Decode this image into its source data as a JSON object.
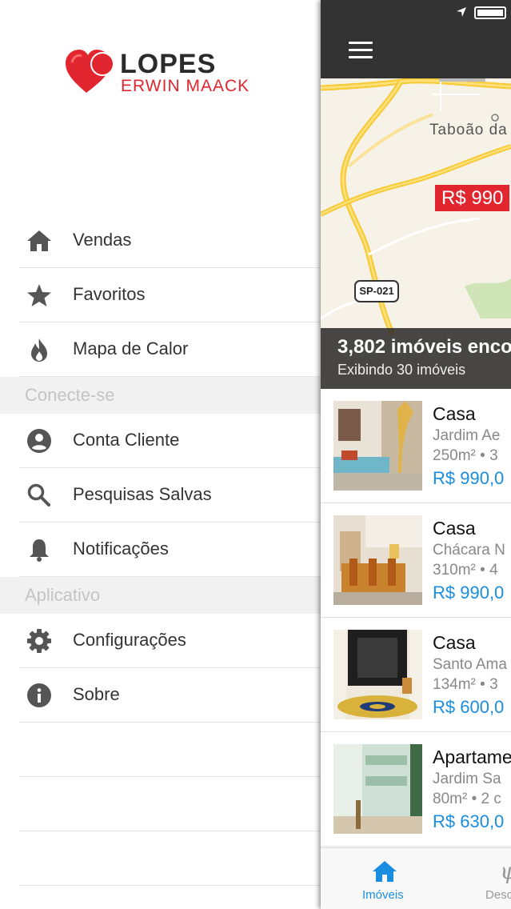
{
  "logo": {
    "brand": "LOPES",
    "sub": "ERWIN MAACK"
  },
  "menu": {
    "main_items": [
      {
        "label": "Vendas",
        "icon": "home-icon"
      },
      {
        "label": "Favoritos",
        "icon": "star-icon"
      },
      {
        "label": "Mapa de Calor",
        "icon": "flame-icon"
      }
    ],
    "section_connect": "Conecte-se",
    "connect_items": [
      {
        "label": "Conta Cliente",
        "icon": "account-icon"
      },
      {
        "label": "Pesquisas Salvas",
        "icon": "search-icon"
      },
      {
        "label": "Notificações",
        "icon": "bell-icon"
      }
    ],
    "section_app": "Aplicativo",
    "app_items": [
      {
        "label": "Configurações",
        "icon": "gear-icon"
      },
      {
        "label": "Sobre",
        "icon": "info-icon"
      }
    ]
  },
  "map": {
    "city_label": "Taboão da",
    "price_pin": "R$ 990",
    "road_badge": "SP-021",
    "count_text": "3,802 imóveis enco",
    "showing_text": "Exibindo 30 imóveis"
  },
  "listings": [
    {
      "type": "Casa",
      "neighborhood": "Jardim Ae",
      "area": "250m² • 3",
      "price": "R$ 990,0"
    },
    {
      "type": "Casa",
      "neighborhood": "Chácara N",
      "area": "310m² • 4",
      "price": "R$ 990,0"
    },
    {
      "type": "Casa",
      "neighborhood": "Santo Ama",
      "area": "134m² • 3",
      "price": "R$ 600,0"
    },
    {
      "type": "Apartame",
      "neighborhood": "Jardim Sa",
      "area": "80m² • 2 c",
      "price": "R$ 630,0"
    }
  ],
  "tabbar": {
    "tab1": "Imóveis",
    "tab2": "Desc"
  },
  "colors": {
    "accent": "#1a8de0",
    "brand_red": "#e2262f",
    "navbar": "#333333"
  }
}
